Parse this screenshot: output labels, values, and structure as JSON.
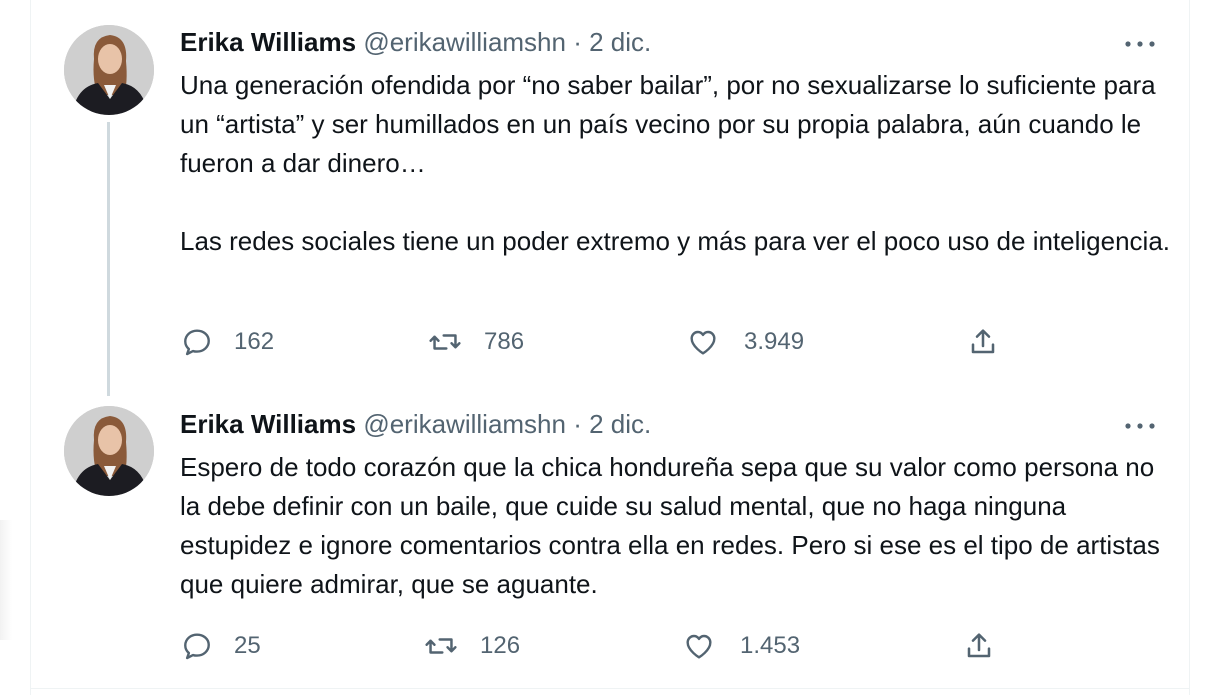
{
  "tweets": [
    {
      "name": "Erika Williams",
      "handle": "@erikawilliamshn",
      "separator": "·",
      "date": "2 dic.",
      "paragraphs": [
        "Una generación ofendida por “no saber bailar”, por no sexualizarse lo suficiente para un “artista” y ser humillados en un país vecino por su propia palabra, aún cuando le fueron a dar dinero…",
        "Las redes sociales tiene un poder extremo y más para ver el poco uso de inteligencia."
      ],
      "replies": "162",
      "retweets": "786",
      "likes": "3.949"
    },
    {
      "name": "Erika Williams",
      "handle": "@erikawilliamshn",
      "separator": "·",
      "date": "2 dic.",
      "paragraphs": [
        "Espero de todo corazón que la chica hondureña sepa que su valor como persona no la debe definir con un baile, que cuide su salud mental, que no haga ninguna estupidez e ignore comentarios contra ella en redes. Pero si ese es el tipo de artistas que quiere admirar, que se aguante."
      ],
      "replies": "25",
      "retweets": "126",
      "likes": "1.453"
    }
  ],
  "icons": {
    "reply": "reply-icon",
    "retweet": "retweet-icon",
    "like": "heart-icon",
    "share": "share-icon",
    "more": "more-options-icon"
  },
  "colors": {
    "text": "#0f1419",
    "secondary": "#536471",
    "thread_line": "#cfd9de"
  }
}
